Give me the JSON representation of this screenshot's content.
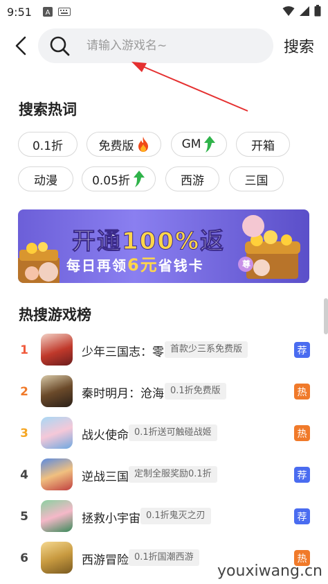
{
  "status_bar": {
    "time": "9:51",
    "icons_left": [
      "a-app-icon",
      "keyboard-icon"
    ],
    "icons_right": [
      "wifi-icon",
      "signal-icon",
      "battery-icon"
    ]
  },
  "search": {
    "placeholder": "请输入游戏名~",
    "value": "",
    "submit_label": "搜索"
  },
  "hot_words": {
    "title": "搜索热词",
    "tags": [
      {
        "label": "0.1折",
        "icon": ""
      },
      {
        "label": "免费版",
        "icon": "fire-icon"
      },
      {
        "label": "GM",
        "icon": "up-arrow-icon"
      },
      {
        "label": "开箱",
        "icon": ""
      },
      {
        "label": "动漫",
        "icon": ""
      },
      {
        "label": "0.05折",
        "icon": "up-arrow-icon"
      },
      {
        "label": "西游",
        "icon": ""
      },
      {
        "label": "三国",
        "icon": ""
      }
    ]
  },
  "banner": {
    "line1_a": "开通",
    "line1_b": "100%",
    "line1_c": "返",
    "line2_a": "每日再领",
    "line2_b": "6元",
    "line2_c": "省钱卡",
    "tag": "尊"
  },
  "ranking": {
    "title": "热搜游戏榜",
    "items": [
      {
        "rank": "1",
        "name": "少年三国志：零",
        "desc": "首款少三系免费版",
        "badge": "荐",
        "badge_color": "#4a6cf0",
        "rank_color": "#f05a3c"
      },
      {
        "rank": "2",
        "name": "秦时明月：沧海",
        "desc": "0.1折免费版",
        "badge": "热",
        "badge_color": "#f07a2a",
        "rank_color": "#f07a2a"
      },
      {
        "rank": "3",
        "name": "战火使命",
        "desc": "0.1折送可触碰战姬",
        "badge": "热",
        "badge_color": "#f07a2a",
        "rank_color": "#f5a623"
      },
      {
        "rank": "4",
        "name": "逆战三国",
        "desc": "定制全服奖励0.1折",
        "badge": "荐",
        "badge_color": "#4a6cf0",
        "rank_color": "#444444"
      },
      {
        "rank": "5",
        "name": "拯救小宇宙",
        "desc": "0.1折鬼灭之刃",
        "badge": "荐",
        "badge_color": "#4a6cf0",
        "rank_color": "#444444"
      },
      {
        "rank": "6",
        "name": "西游冒险",
        "desc": "0.1折国潮西游",
        "badge": "热",
        "badge_color": "#f07a2a",
        "rank_color": "#444444"
      }
    ]
  },
  "watermark": "youxiwang.cn"
}
